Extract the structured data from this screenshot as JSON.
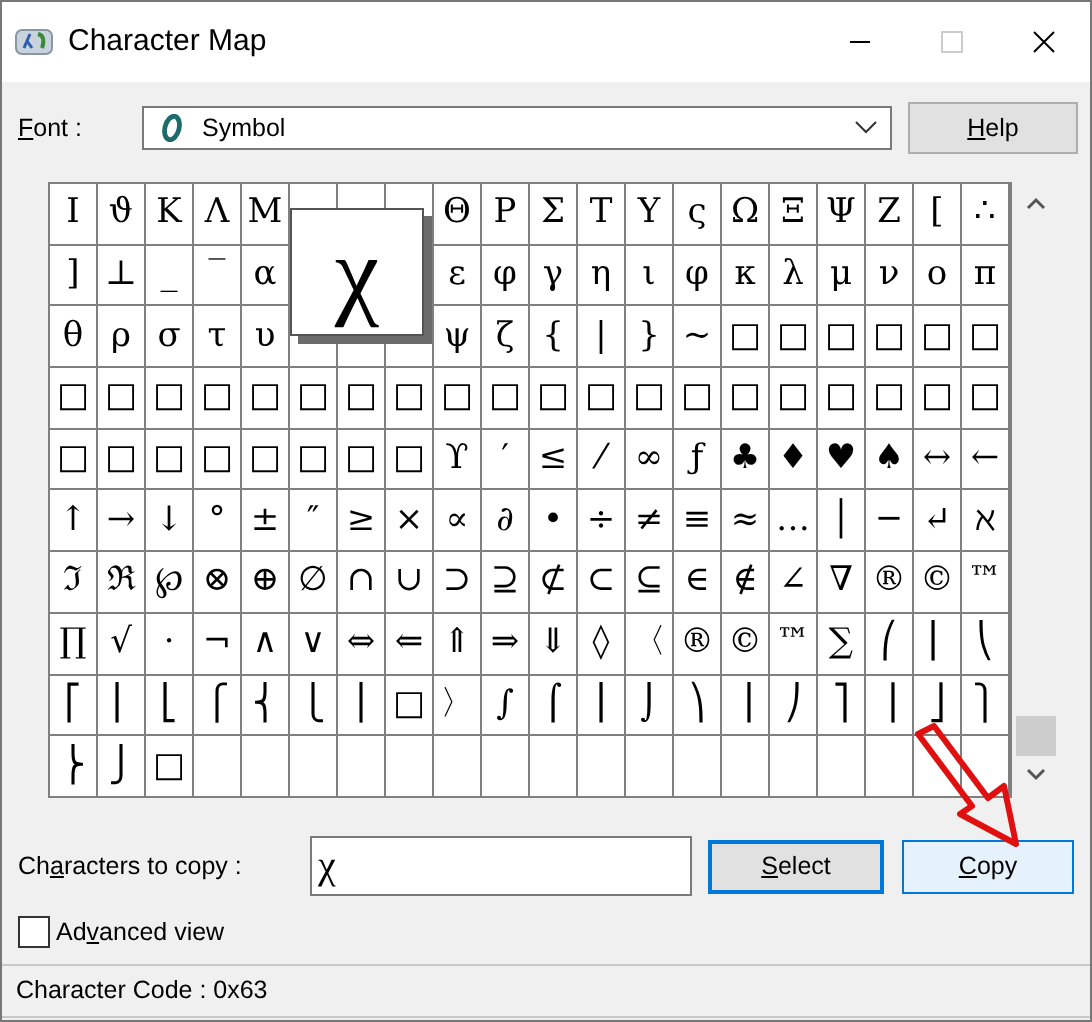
{
  "window": {
    "title": "Character Map"
  },
  "font": {
    "label": {
      "key": "F",
      "after": "ont :"
    },
    "value": "Symbol"
  },
  "help_button": {
    "key": "H",
    "after": "elp"
  },
  "grid": [
    {
      "cells": [
        "Ι",
        "ϑ",
        "Κ",
        "Λ",
        "Μ"
      ],
      "cells_after_magnifier": [
        "Θ",
        "Ρ",
        "Σ",
        "Τ",
        "Υ",
        "ς",
        "Ω",
        "Ξ",
        "Ψ",
        "Ζ",
        "[",
        "∴"
      ]
    },
    {
      "cells": [
        "]",
        "⊥",
        "_",
        "‾",
        "α"
      ],
      "cells_after_magnifier": [
        "ε",
        "φ",
        "γ",
        "η",
        "ι",
        "φ",
        "κ",
        "λ",
        "μ",
        "ν",
        "ο",
        "π"
      ]
    },
    {
      "cells": [
        "θ",
        "ρ",
        "σ",
        "τ",
        "υ"
      ],
      "cells_after_magnifier": [
        "ψ",
        "ζ",
        "{",
        "|",
        "}",
        "~",
        "□",
        "□",
        "□",
        "□",
        "□",
        "□"
      ]
    },
    {
      "cells": [
        "□",
        "□",
        "□",
        "□",
        "□",
        "□",
        "□",
        "□",
        "□",
        "□",
        "□",
        "□",
        "□",
        "□",
        "□",
        "□",
        "□",
        "□",
        "□",
        "□"
      ]
    },
    {
      "cells": [
        "□",
        "□",
        "□",
        "□",
        "□",
        "□",
        "□",
        "□",
        "ϒ",
        "′",
        "≤",
        "⁄",
        "∞",
        "ƒ",
        "♣",
        "♦",
        "♥",
        "♠",
        "↔",
        "←"
      ]
    },
    {
      "cells": [
        "↑",
        "→",
        "↓",
        "°",
        "±",
        "″",
        "≥",
        "×",
        "∝",
        "∂",
        "•",
        "÷",
        "≠",
        "≡",
        "≈",
        "…",
        "│",
        "─",
        "↵",
        "ℵ"
      ]
    },
    {
      "cells": [
        "ℑ",
        "ℜ",
        "℘",
        "⊗",
        "⊕",
        "∅",
        "∩",
        "∪",
        "⊃",
        "⊇",
        "⊄",
        "⊂",
        "⊆",
        "∈",
        "∉",
        "∠",
        "∇",
        "®",
        "©",
        "™"
      ]
    },
    {
      "cells": [
        "∏",
        "√",
        "⋅",
        "¬",
        "∧",
        "∨",
        "⇔",
        "⇐",
        "⇑",
        "⇒",
        "⇓",
        "◊",
        "〈",
        "®",
        "©",
        "™",
        "∑",
        "⎛",
        "⎜",
        "⎝"
      ]
    },
    {
      "cells": [
        "⎡",
        "⎢",
        "⎣",
        "⎧",
        "⎨",
        "⎩",
        "⎪",
        "□",
        "〉",
        "∫",
        "⌠",
        "⎮",
        "⌡",
        "⎞",
        "⎟",
        "⎠",
        "⎤",
        "⎥",
        "⎦",
        "⎫"
      ]
    },
    {
      "cells": [
        "⎬",
        "⎭",
        "□"
      ]
    }
  ],
  "magnifier": {
    "char": "χ"
  },
  "copy_row": {
    "label": {
      "before": "Ch",
      "key": "a",
      "after": "racters to copy :"
    },
    "value": "χ",
    "select_button": {
      "key": "S",
      "after": "elect"
    },
    "copy_button": {
      "key": "C",
      "after": "opy",
      "hovered": true
    }
  },
  "advanced_view": {
    "label": {
      "before": "Ad",
      "key": "v",
      "after": "anced view"
    },
    "checked": false
  },
  "status_bar": {
    "text": "Character Code : 0x63"
  }
}
